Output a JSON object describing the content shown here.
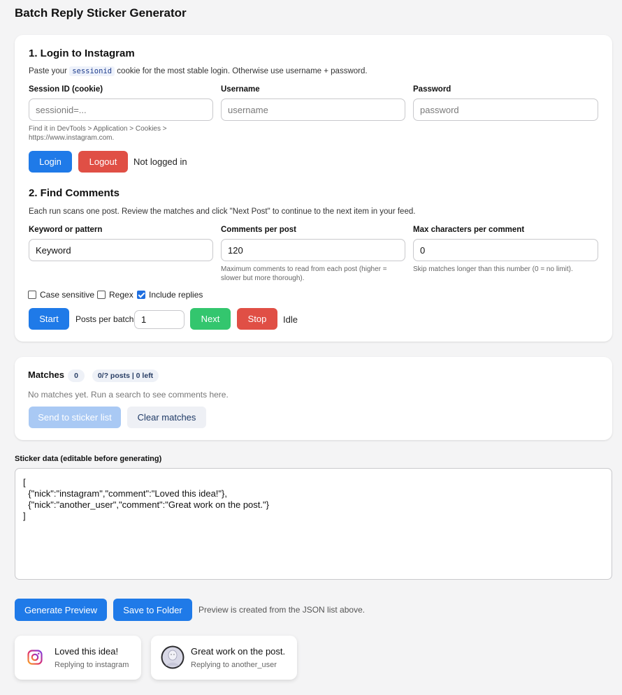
{
  "page_title": "Batch Reply Sticker Generator",
  "login": {
    "title": "1. Login to Instagram",
    "desc_before": "Paste your",
    "desc_code": "sessionid",
    "desc_after": "cookie for the most stable login. Otherwise use username + password.",
    "session_label": "Session ID (cookie)",
    "session_placeholder": "sessionid=...",
    "session_value": "",
    "session_hint": "Find it in DevTools > Application > Cookies > https://www.instagram.com.",
    "username_label": "Username",
    "username_placeholder": "username",
    "username_value": "",
    "password_label": "Password",
    "password_placeholder": "password",
    "password_value": "",
    "login_button": "Login",
    "logout_button": "Logout",
    "status": "Not logged in"
  },
  "find": {
    "title": "2. Find Comments",
    "desc": "Each run scans one post. Review the matches and click \"Next Post\" to continue to the next item in your feed.",
    "keyword_label": "Keyword or pattern",
    "keyword_value": "Keyword",
    "comments_label": "Comments per post",
    "comments_value": "120",
    "comments_hint": "Maximum comments to read from each post (higher = slower but more thorough).",
    "maxchars_label": "Max characters per comment",
    "maxchars_value": "0",
    "maxchars_hint": "Skip matches longer than this number (0 = no limit).",
    "case_sensitive_label": "Case sensitive",
    "case_sensitive_checked": false,
    "regex_label": "Regex",
    "regex_checked": false,
    "include_replies_label": "Include replies",
    "include_replies_checked": true,
    "start_button": "Start",
    "posts_per_batch_label": "Posts per batch",
    "posts_per_batch_value": "1",
    "next_button": "Next",
    "stop_button": "Stop",
    "status": "Idle"
  },
  "matches": {
    "title": "Matches",
    "count": "0",
    "progress": "0/? posts | 0 left",
    "empty_text": "No matches yet. Run a search to see comments here.",
    "send_button": "Send to sticker list",
    "clear_button": "Clear matches"
  },
  "sticker": {
    "label": "Sticker data (editable before generating)",
    "json": "[\n  {\"nick\":\"instagram\",\"comment\":\"Loved this idea!\"},\n  {\"nick\":\"another_user\",\"comment\":\"Great work on the post.\"}\n]",
    "generate_button": "Generate Preview",
    "save_button": "Save to Folder",
    "note": "Preview is created from the JSON list above."
  },
  "previews": [
    {
      "comment": "Loved this idea!",
      "reply": "Replying to instagram",
      "icon": "instagram-logo-icon"
    },
    {
      "comment": "Great work on the post.",
      "reply": "Replying to another_user",
      "icon": "default-avatar-icon"
    }
  ],
  "colors": {
    "primary": "#1f7ae8",
    "danger": "#e04f45",
    "success": "#33c66e",
    "background": "#f4f4f5"
  }
}
